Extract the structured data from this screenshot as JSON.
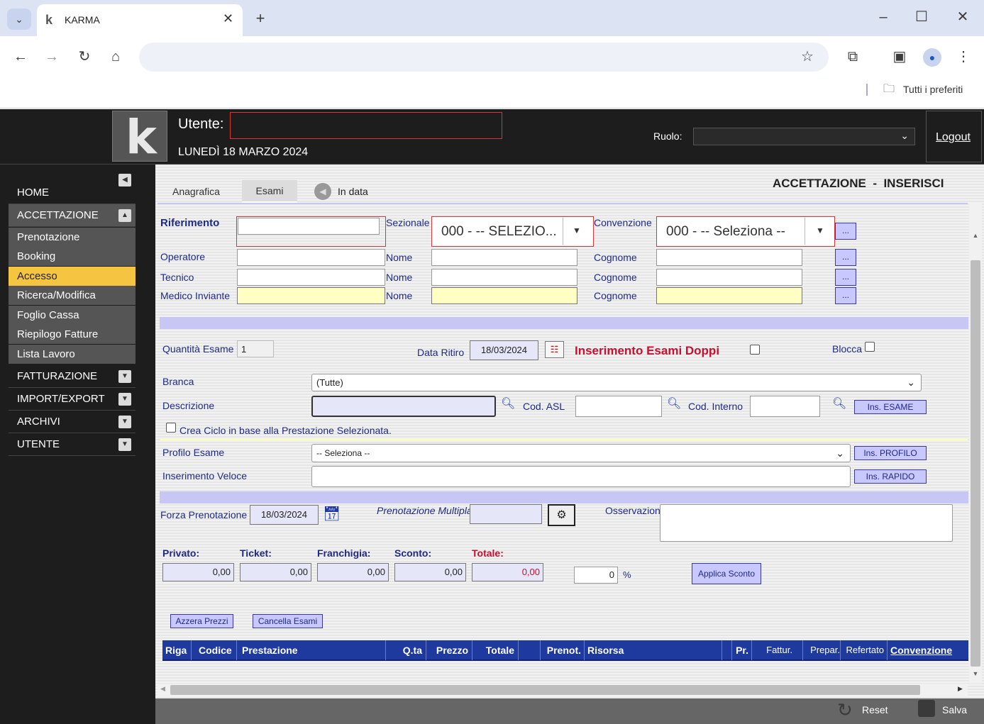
{
  "browser": {
    "tab_title": "KARMA",
    "bookmarks_label": "Tutti i preferiti"
  },
  "header": {
    "user_label": "Utente:",
    "date": "LUNEDÌ 18 MARZO 2024",
    "role_label": "Ruolo:",
    "logout": "Logout"
  },
  "sidebar": {
    "home": "HOME",
    "accettazione": "ACCETTAZIONE",
    "sub": [
      "Prenotazione",
      "Booking",
      "Accesso",
      "Ricerca/Modifica",
      "Foglio Cassa",
      "Riepilogo Fatture",
      "Lista Lavoro"
    ],
    "fatturazione": "FATTURAZIONE",
    "import_export": "IMPORT/EXPORT",
    "archivi": "ARCHIVI",
    "utente": "UTENTE"
  },
  "tabs": {
    "anagrafica": "Anagrafica",
    "esami": "Esami",
    "in_data": "In data"
  },
  "page_title": "ACCETTAZIONE  -  INSERISCI",
  "form": {
    "riferimento": "Riferimento",
    "sezionale": "Sezionale",
    "sezionale_value": "000 - -- SELEZIO...",
    "convenzione": "Convenzione",
    "convenzione_value": "000 - -- Seleziona --",
    "operatore": "Operatore",
    "tecnico": "Tecnico",
    "medico": "Medico Inviante",
    "nome": "Nome",
    "cognome": "Cognome",
    "dots": "...",
    "quantita_label": "Quantità Esame",
    "quantita_value": "1",
    "data_ritiro_label": "Data Ritiro",
    "data_ritiro_value": "18/03/2024",
    "doppi_label": "Inserimento Esami Doppi",
    "blocca": "Blocca",
    "branca_label": "Branca",
    "branca_value": "(Tutte)",
    "descrizione": "Descrizione",
    "cod_asl": "Cod. ASL",
    "cod_interno": "Cod. Interno",
    "ins_esame": "Ins. ESAME",
    "crea_ciclo": "Crea Ciclo in base alla Prestazione Selezionata.",
    "profilo_label": "Profilo Esame",
    "profilo_value": "-- Seleziona --",
    "ins_profilo": "Ins. PROFILO",
    "veloce_label": "Inserimento Veloce",
    "ins_rapido": "Ins. RAPIDO",
    "forza_label": "Forza Prenotazione",
    "forza_value": "18/03/2024",
    "multipla_label": "Prenotazione Multipla",
    "osservazioni": "Osservazioni"
  },
  "totals": {
    "privato_label": "Privato:",
    "privato": "0,00",
    "ticket_label": "Ticket:",
    "ticket": "0,00",
    "franchigia_label": "Franchigia:",
    "franchigia": "0,00",
    "sconto_label": "Sconto:",
    "sconto": "0,00",
    "totale_label": "Totale:",
    "totale": "0,00",
    "percent_value": "0",
    "percent": "%",
    "applica": "Applica Sconto"
  },
  "buttons": {
    "azzera": "Azzera Prezzi",
    "cancella": "Cancella Esami"
  },
  "table_headers": [
    "Riga",
    "Codice",
    "Prestazione",
    "Q.ta",
    "Prezzo",
    "Totale",
    "",
    "Prenot.",
    "Risorsa",
    "",
    "Pr.",
    "Fattur.",
    "Prepar.",
    "Refertato",
    "Convenzione"
  ],
  "footer": {
    "reset": "Reset",
    "salva": "Salva"
  },
  "colors": {
    "accent": "#f5c542",
    "header_blue": "#1e3a9e",
    "red": "#c8102e"
  }
}
